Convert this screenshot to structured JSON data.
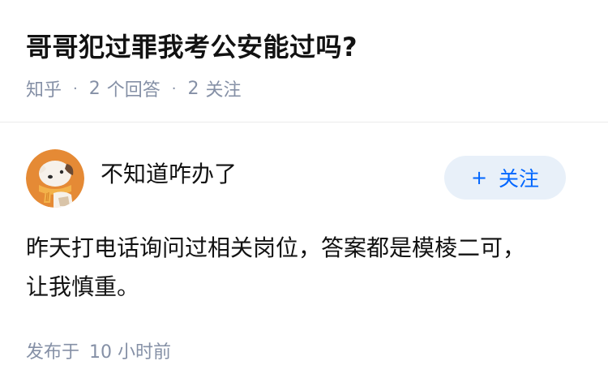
{
  "question": {
    "title": "哥哥犯过罪我考公安能过吗?",
    "source": "知乎",
    "answer_count": "2",
    "answer_label": "个回答",
    "follower_count": "2",
    "follower_label": "关注",
    "separator": "·"
  },
  "answer": {
    "author": {
      "name": "不知道咋办了",
      "avatar_icon": "cartoon-dog-avatar"
    },
    "follow_button": {
      "icon": "plus-icon",
      "symbol": "+",
      "label": "关注"
    },
    "body_lines": [
      "昨天打电话询问过相关岗位，答案都是模棱二可，",
      "让我慎重。"
    ],
    "posted_label": "发布于",
    "posted_time": "10 小时前"
  },
  "colors": {
    "title": "#121212",
    "meta": "#8590a6",
    "accent": "#0066ff",
    "follow_bg": "#e8f0f9",
    "avatar_bg": "#e58a35"
  }
}
